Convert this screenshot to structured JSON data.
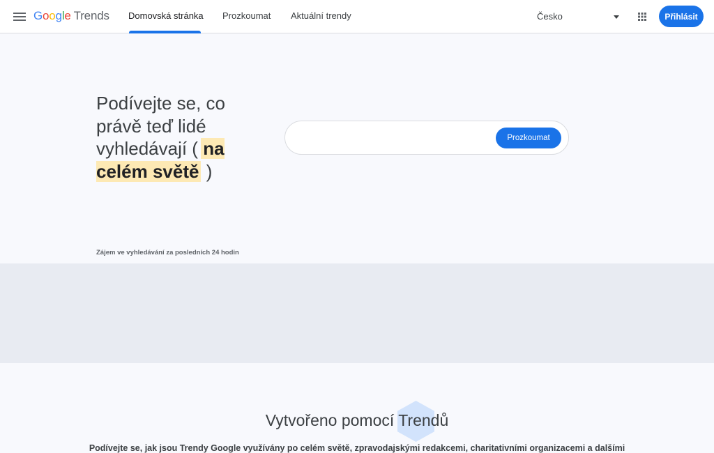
{
  "header": {
    "logo": {
      "brand": "Google",
      "product": "Trends"
    },
    "nav": [
      {
        "label": "Domovská stránka",
        "active": true
      },
      {
        "label": "Prozkoumat",
        "active": false
      },
      {
        "label": "Aktuální trendy",
        "active": false
      }
    ],
    "country": "Česko",
    "signin_label": "Přihlásit",
    "icons": {
      "menu": "hamburger-menu-icon",
      "dropdown": "dropdown-arrow-icon",
      "apps": "apps-grid-icon"
    }
  },
  "hero": {
    "headline_main": "Podívejte se, co právě teď lidé vyhledávají (",
    "headline_highlight": "na celém světě",
    "headline_end": ")",
    "search_value": "",
    "explore_label": "Prozkoumat",
    "interest_caption": "Zájem ve vyhledávání za posledních 24 hodin"
  },
  "bottom": {
    "title": "Vytvořeno pomocí Trendů",
    "description": "Podívejte se, jak jsou Trendy Google využívány po celém světě, zpravodajskými redakcemi, charitativními organizacemi a dalšími"
  },
  "colors": {
    "accent": "#1a73e8",
    "highlight": "#fde9b4",
    "page_background": "#f8f9fd",
    "band_background": "#e8ebf2",
    "hexagon": "#d2e3fc"
  }
}
